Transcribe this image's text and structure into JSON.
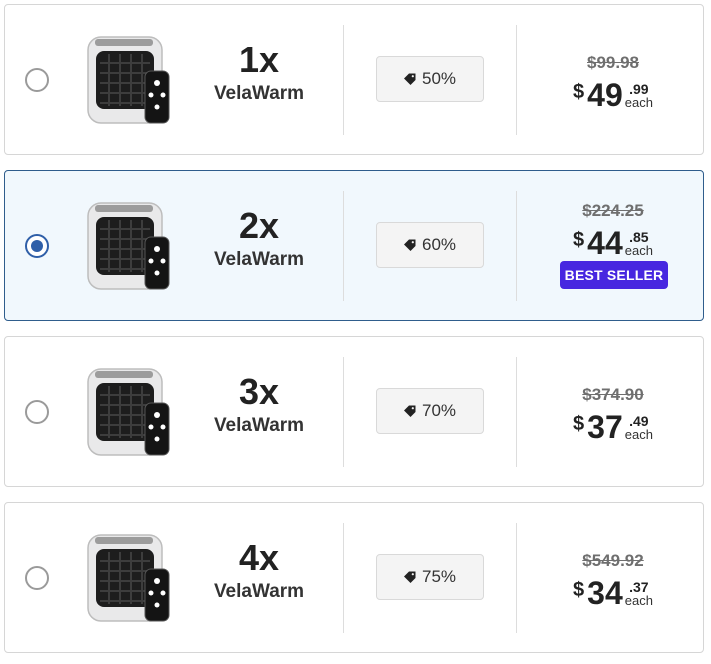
{
  "colors": {
    "accent": "#2f5fa8",
    "selected_background": "#f1f8fd",
    "badge": "#4727e0"
  },
  "offers": [
    {
      "selected": false,
      "quantity": "1x",
      "product": "VelaWarm",
      "discount": "50%",
      "old_price": "$99.98",
      "currency": "$",
      "price_dollars": "49",
      "price_cents": ".99",
      "per_unit": "each",
      "badge": ""
    },
    {
      "selected": true,
      "quantity": "2x",
      "product": "VelaWarm",
      "discount": "60%",
      "old_price": "$224.25",
      "currency": "$",
      "price_dollars": "44",
      "price_cents": ".85",
      "per_unit": "each",
      "badge": "BEST SELLER"
    },
    {
      "selected": false,
      "quantity": "3x",
      "product": "VelaWarm",
      "discount": "70%",
      "old_price": "$374.90",
      "currency": "$",
      "price_dollars": "37",
      "price_cents": ".49",
      "per_unit": "each",
      "badge": ""
    },
    {
      "selected": false,
      "quantity": "4x",
      "product": "VelaWarm",
      "discount": "75%",
      "old_price": "$549.92",
      "currency": "$",
      "price_dollars": "34",
      "price_cents": ".37",
      "per_unit": "each",
      "badge": ""
    }
  ]
}
